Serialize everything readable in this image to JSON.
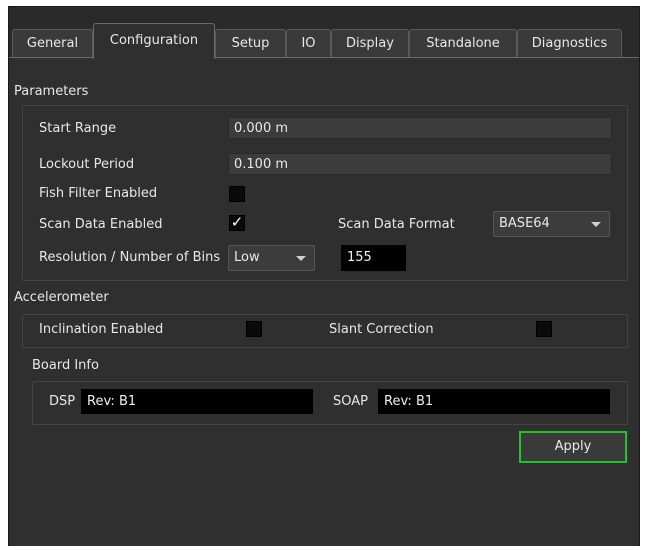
{
  "tabs": [
    {
      "label": "General"
    },
    {
      "label": "Configuration"
    },
    {
      "label": "Setup"
    },
    {
      "label": "IO"
    },
    {
      "label": "Display"
    },
    {
      "label": "Standalone"
    },
    {
      "label": "Diagnostics"
    }
  ],
  "active_tab": "Configuration",
  "parameters": {
    "title": "Parameters",
    "start_range_label": "Start Range",
    "start_range_value": "0.000 m",
    "lockout_period_label": "Lockout Period",
    "lockout_period_value": "0.100 m",
    "fish_filter_label": "Fish Filter Enabled",
    "fish_filter_checked": false,
    "scan_data_label": "Scan Data Enabled",
    "scan_data_checked": true,
    "scan_data_check_glyph": "✓",
    "scan_data_format_label": "Scan Data Format",
    "scan_data_format_value": "BASE64",
    "resolution_label": "Resolution / Number of Bins",
    "resolution_value": "Low",
    "bins_value": "155"
  },
  "accelerometer": {
    "title": "Accelerometer",
    "inclination_label": "Inclination Enabled",
    "inclination_checked": false,
    "slant_label": "Slant Correction",
    "slant_checked": false
  },
  "board_info": {
    "title": "Board Info",
    "dsp_label": "DSP",
    "dsp_value": "Rev: B1",
    "soap_label": "SOAP",
    "soap_value": "Rev: B1"
  },
  "apply_label": "Apply",
  "colors": {
    "background": "#2f2f2f",
    "apply_border": "#22c22a",
    "field_background": "#3c3c3c"
  }
}
